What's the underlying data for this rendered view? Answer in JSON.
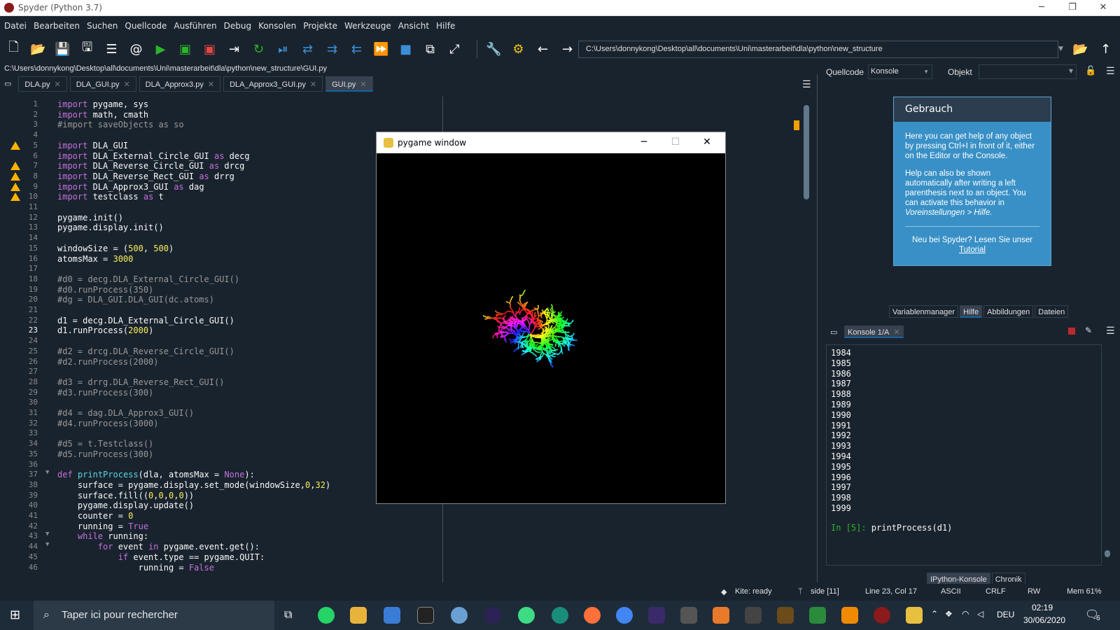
{
  "window": {
    "title": "Spyder (Python 3.7)"
  },
  "menu": [
    "Datei",
    "Bearbeiten",
    "Suchen",
    "Quellcode",
    "Ausführen",
    "Debug",
    "Konsolen",
    "Projekte",
    "Werkzeuge",
    "Ansicht",
    "Hilfe"
  ],
  "toolbar": {
    "path": "C:\\Users\\donnykong\\Desktop\\all\\documents\\Uni\\masterarbeit\\dla\\python\\new_structure"
  },
  "editor": {
    "filepath": "C:\\Users\\donnykong\\Desktop\\all\\documents\\Uni\\masterarbeit\\dla\\python\\new_structure\\GUI.py",
    "tabs": [
      "DLA.py",
      "DLA_GUI.py",
      "DLA_Approx3.py",
      "DLA_Approx3_GUI.py",
      "GUI.py"
    ],
    "active_tab": "GUI.py",
    "current_line": 23
  },
  "pygame": {
    "title": "pygame window"
  },
  "help": {
    "source_label": "Quellcode",
    "source_value": "Konsole",
    "object_label": "Objekt",
    "title": "Gebrauch",
    "p1": "Here you can get help of any object by pressing Ctrl+I in front of it, either on the Editor or the Console.",
    "p2a": "Help can also be shown automatically after writing a left parenthesis next to an object. You can activate this behavior in",
    "p2b": "Voreinstellungen > Hilfe.",
    "p3": "Neu bei Spyder? Lesen Sie unser",
    "p3link": "Tutorial",
    "tabs": [
      "Variablenmanager",
      "Hilfe",
      "Abbildungen",
      "Dateien"
    ]
  },
  "console": {
    "tab": "Konsole 1/A",
    "lines": [
      "1984",
      "1985",
      "1986",
      "1987",
      "1988",
      "1989",
      "1990",
      "1991",
      "1992",
      "1993",
      "1994",
      "1995",
      "1996",
      "1997",
      "1998",
      "1999"
    ],
    "prompt": "In [5]:",
    "input": "printProcess(d1)",
    "bottom_tabs": [
      "IPython-Konsole",
      "Chronik"
    ]
  },
  "status": {
    "kite": "Kite: ready",
    "branch": "side [11]",
    "cursor": "Line 23, Col 17",
    "encoding": "ASCII",
    "eol": "CRLF",
    "mode": "RW",
    "mem": "Mem 61%"
  },
  "taskbar": {
    "search_placeholder": "Taper ici pour rechercher",
    "lang": "DEU",
    "time": "02:19",
    "date": "30/06/2020",
    "notif": "6"
  },
  "colors": {
    "accent": "#1464a0",
    "help_bg": "#3990c6",
    "bg": "#19232d"
  }
}
